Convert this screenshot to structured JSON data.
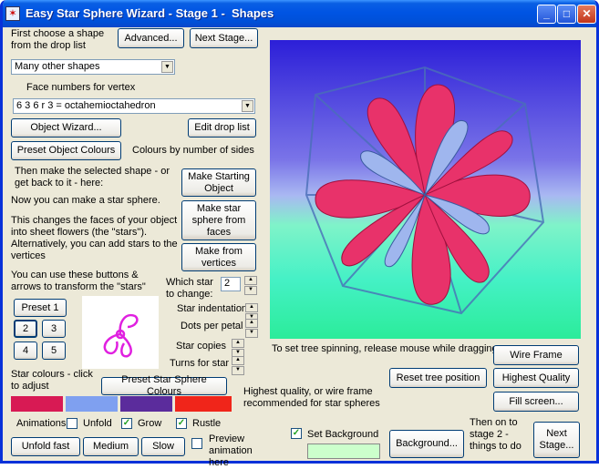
{
  "window": {
    "title": "Easy Star Sphere Wizard - Stage 1 -  Shapes"
  },
  "text": {
    "choose_shape": "First choose a shape from the drop list",
    "face_numbers": "Face numbers for vertex",
    "colours_by_sides": "Colours by number of sides",
    "then_make": "Then make the selected shape - or get back to it - here:",
    "now_you_can": "Now you can make a star sphere.",
    "this_changes": "This changes the faces of your object into sheet flowers (the \"stars\"). Alternatively, you can add stars to the vertices",
    "you_can_use": "You can use these buttons & arrows to transform the \"stars\"",
    "which_star": "Which star to change:",
    "star_indentation": "Star indentation",
    "dots_per_petal": "Dots per petal",
    "star_copies": "Star copies",
    "turns_for_star": "Turns for star",
    "star_colours": "Star colours - click to adjust",
    "animations": "Animations",
    "tree_spinning": "To set tree spinning, release mouse while dragging",
    "highest_quality_note": "Highest quality, or wire frame recommended for star spheres",
    "then_on": "Then on to stage 2 - things to do"
  },
  "buttons": {
    "advanced": "Advanced...",
    "next_stage_top": "Next Stage...",
    "object_wizard": "Object Wizard...",
    "edit_drop_list": "Edit drop list",
    "preset_object_colours": "Preset Object Colours",
    "make_starting_object": "Make Starting Object",
    "make_star_sphere": "Make star sphere from faces",
    "make_from_vertices": "Make from vertices",
    "preset1": "Preset 1",
    "preset2": "2",
    "preset3": "3",
    "preset4": "4",
    "preset5": "5",
    "preset_star_sphere_colours": "Preset Star Sphere Colours",
    "unfold_fast": "Unfold fast",
    "medium": "Medium",
    "slow": "Slow",
    "wire_frame": "Wire Frame",
    "reset_tree_position": "Reset tree position",
    "highest_quality": "Highest Quality",
    "fill_screen": "Fill screen...",
    "background": "Background...",
    "next_stage_bottom": "Next Stage..."
  },
  "selects": {
    "shape": "Many other shapes",
    "vertex": "6 3 6 r 3 = octahemioctahedron"
  },
  "which_star_value": "2",
  "checkboxes": {
    "unfold": {
      "label": "Unfold",
      "checked": false
    },
    "grow": {
      "label": "Grow",
      "checked": true
    },
    "rustle": {
      "label": "Rustle",
      "checked": true
    },
    "preview": {
      "label": "Preview animation here",
      "checked": false
    },
    "set_background": {
      "label": "Set Background",
      "checked": true
    }
  },
  "colors": {
    "star1": "#d81a54",
    "star2": "#7fa0f0",
    "star3": "#5b2c9c",
    "star4": "#f0251a",
    "background_swatch": "#ccffcc",
    "petal": "#e8326a",
    "preview_star": "#e020e0"
  }
}
